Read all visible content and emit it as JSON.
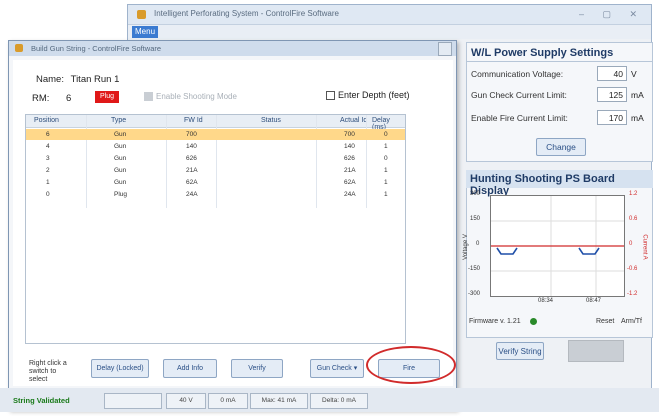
{
  "main_window": {
    "title": "Intelligent Perforating System - ControlFire Software",
    "menu_item": "Menu",
    "window_controls": "– ▢ ✕"
  },
  "power_supply": {
    "title": "W/L Power Supply Settings",
    "rows": [
      {
        "label": "Communication Voltage:",
        "value": "40",
        "unit": "V"
      },
      {
        "label": "Gun Check Current Limit:",
        "value": "125",
        "unit": "mA"
      },
      {
        "label": "Enable Fire Current Limit:",
        "value": "170",
        "unit": "mA"
      }
    ],
    "change_button": "Change"
  },
  "shooting_panel": {
    "title": "Hunting Shooting PS Board Display",
    "y_left_label": "Voltage V",
    "y_right_label": "Current A",
    "left_ticks": [
      "300",
      "150",
      "0",
      "-150",
      "-300"
    ],
    "right_ticks": [
      "1.2",
      "0.6",
      "0",
      "-0.6",
      "-1.2"
    ],
    "x_ticks": [
      "08:34",
      "08:47"
    ],
    "firmware": "Firmware v. 1.21",
    "reset": "Reset",
    "arm": "Arm/Tf",
    "verify_button": "Verify String"
  },
  "dialog": {
    "title": "Build Gun String - ControlFire Software",
    "name_label": "Name:",
    "name_value": "Titan Run 1",
    "rm_label": "RM:",
    "rm_value": "6",
    "plug_badge": "Plug",
    "gray_option": "Enable Shooting Mode",
    "depth_label": "Enter Depth (feet)",
    "columns": [
      "Position",
      "Type",
      "FW Id",
      "Status",
      "Actual Id",
      "Delay (ms)"
    ],
    "rows": [
      {
        "position": "6",
        "type": "Gun",
        "fw": "700",
        "status": "",
        "actual": "700",
        "delay": "0"
      },
      {
        "position": "4",
        "type": "Gun",
        "fw": "140",
        "status": "",
        "actual": "140",
        "delay": "1"
      },
      {
        "position": "3",
        "type": "Gun",
        "fw": "626",
        "status": "",
        "actual": "626",
        "delay": "0"
      },
      {
        "position": "2",
        "type": "Gun",
        "fw": "21A",
        "status": "",
        "actual": "21A",
        "delay": "1"
      },
      {
        "position": "1",
        "type": "Gun",
        "fw": "62A",
        "status": "",
        "actual": "62A",
        "delay": "1"
      },
      {
        "position": "0",
        "type": "Plug",
        "fw": "24A",
        "status": "",
        "actual": "24A",
        "delay": "1"
      }
    ],
    "bottom_note": "Right click a switch to select",
    "buttons": {
      "delay": "Delay (Locked)",
      "add_info": "Add Info",
      "verify": "Verify",
      "gun_check": "Gun Check ▾",
      "fire": "Fire"
    }
  },
  "status_bar": {
    "status": "String Validated",
    "voltage": "40 V",
    "current": "0 mA",
    "max": "Max: 41 mA",
    "delta": "Delta: 0 mA"
  },
  "colors": {
    "selected_row": "#ffd88a",
    "plug_badge": "#e01818",
    "highlight_circle": "#d12b2b",
    "status_ok": "#1a7a1a"
  }
}
